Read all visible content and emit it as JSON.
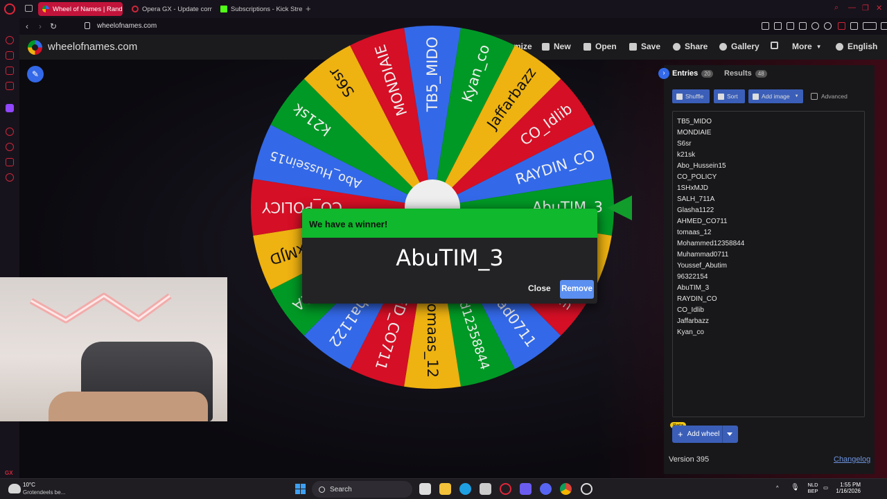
{
  "browser": {
    "tabs": [
      {
        "title": "Wheel of Names | Random",
        "active": true
      },
      {
        "title": "Opera GX - Update comp"
      },
      {
        "title": "Subscriptions - Kick Strea"
      }
    ],
    "url": "wheelofnames.com"
  },
  "site": {
    "name": "wheelofnames.com",
    "menu": {
      "customize": "Customize",
      "new": "New",
      "open": "Open",
      "save": "Save",
      "share": "Share",
      "gallery": "Gallery",
      "more": "More",
      "language": "English"
    }
  },
  "wheel": {
    "colors": [
      "#3369e8",
      "#009925",
      "#eeb211",
      "#d50f25"
    ],
    "segments": [
      "TB5_MIDO",
      "Kyan_co",
      "Jaffarbazz",
      "CO_Idlib",
      "RAYDIN_CO",
      "AbuTIM_3",
      "96322154",
      "Youssef_Abutim",
      "Muhammad0711",
      "Mohammed12358844",
      "tomaas_12",
      "AHMED_CO711",
      "Glasha1122",
      "SALH_711A",
      "1SHxMJD",
      "CO_POLICY",
      "Abo_Hussein15",
      "k21sk",
      "S6sr",
      "MONDIAIE"
    ]
  },
  "modal": {
    "header": "We have a winner!",
    "winner": "AbuTIM_3",
    "close": "Close",
    "remove": "Remove"
  },
  "panel": {
    "entries_tab": "Entries",
    "entries_count": "20",
    "results_tab": "Results",
    "results_count": "48",
    "shuffle": "Shuffle",
    "sort": "Sort",
    "add_image": "Add image",
    "advanced": "Advanced",
    "entries": [
      "TB5_MIDO",
      "MONDIAIE",
      "S6sr",
      "k21sk",
      "Abo_Hussein15",
      "CO_POLICY",
      "1SHxMJD",
      "SALH_711A",
      "Glasha1122",
      "AHMED_CO711",
      "tomaas_12",
      "Mohammed12358844",
      "Muhammad0711",
      "Youssef_Abutim",
      "96322154",
      "AbuTIM_3",
      "RAYDIN_CO",
      "CO_Idlib",
      "Jaffarbazz",
      "Kyan_co"
    ],
    "beta": "Beta",
    "add_wheel": "Add wheel",
    "version": "Version 395",
    "changelog": "Changelog"
  },
  "taskbar": {
    "weather_temp": "10°C",
    "weather_desc": "Grotendeels be...",
    "search": "Search",
    "lang_top": "NLD",
    "lang_bottom": "BEP",
    "time": "1:55 PM",
    "date": "1/16/2026"
  }
}
